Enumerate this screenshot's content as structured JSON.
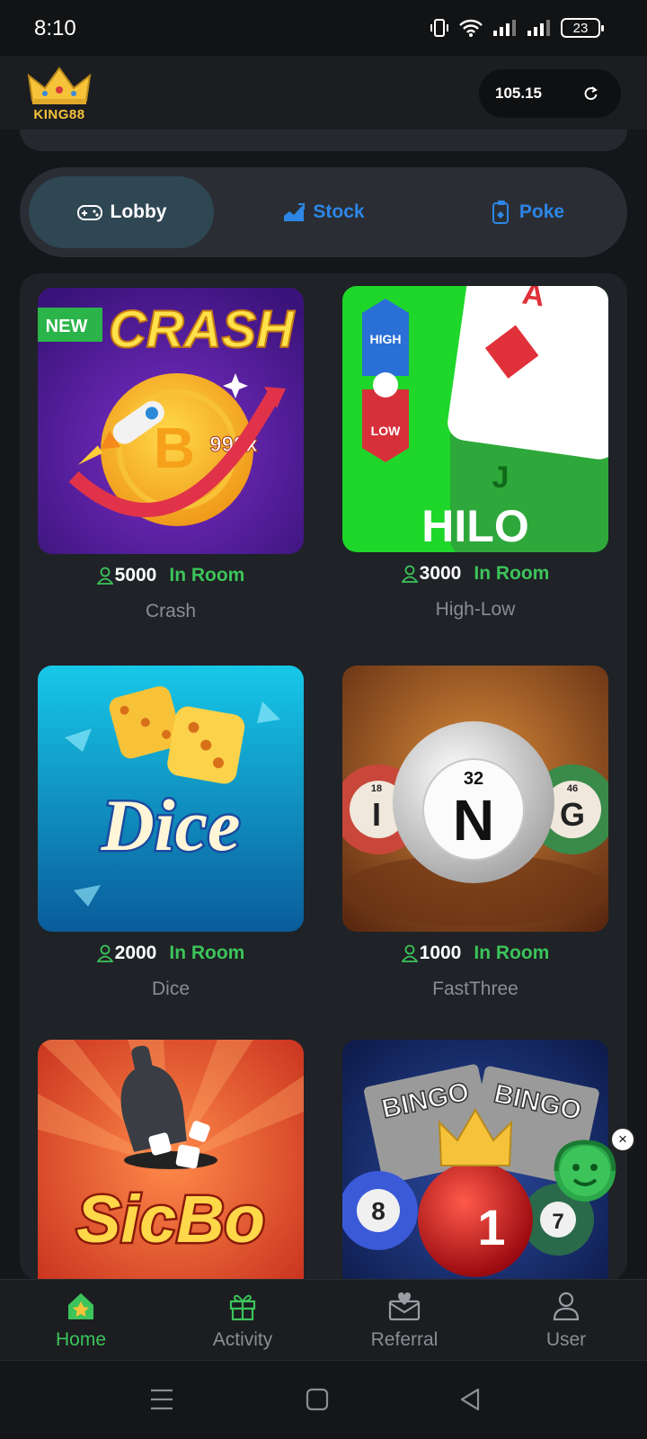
{
  "status_bar": {
    "time": "8:10",
    "battery": "23"
  },
  "header": {
    "logo_text": "KING88",
    "balance": "105.15"
  },
  "tabs": [
    {
      "label": "Lobby",
      "icon": "gamepad-icon",
      "active": true
    },
    {
      "label": "Stock",
      "icon": "chart-icon",
      "active": false
    },
    {
      "label": "Poke",
      "icon": "card-icon",
      "active": false
    }
  ],
  "games": [
    {
      "name": "Crash",
      "players": "5000",
      "status": "In Room",
      "thumb_title": "CRASH",
      "badge": "NEW",
      "multiplier": "999x"
    },
    {
      "name": "High-Low",
      "players": "3000",
      "status": "In Room",
      "thumb_title": "HILO",
      "high": "HIGH",
      "low": "LOW",
      "card_top": "A",
      "card_bottom": "J"
    },
    {
      "name": "Dice",
      "players": "2000",
      "status": "In Room",
      "thumb_title": "Dice"
    },
    {
      "name": "FastThree",
      "players": "1000",
      "status": "In Room",
      "ball_left": "I",
      "ball_left_num": "18",
      "ball_center": "N",
      "ball_center_num": "32",
      "ball_right": "G",
      "ball_right_num": "46"
    },
    {
      "name": "SicBo",
      "thumb_title": "SicBo"
    },
    {
      "name": "Bingo",
      "thumb_title": "BINGO",
      "ball_left": "8",
      "ball_center": "1",
      "ball_right": "7"
    }
  ],
  "bottom_nav": [
    {
      "label": "Home",
      "icon": "home-icon",
      "active": true
    },
    {
      "label": "Activity",
      "icon": "gift-icon",
      "active": false
    },
    {
      "label": "Referral",
      "icon": "envelope-heart-icon",
      "active": false
    },
    {
      "label": "User",
      "icon": "user-icon",
      "active": false
    }
  ],
  "colors": {
    "accent_green": "#3cc45a",
    "tab_blue": "#2d86e6",
    "gold": "#f5c23a"
  }
}
